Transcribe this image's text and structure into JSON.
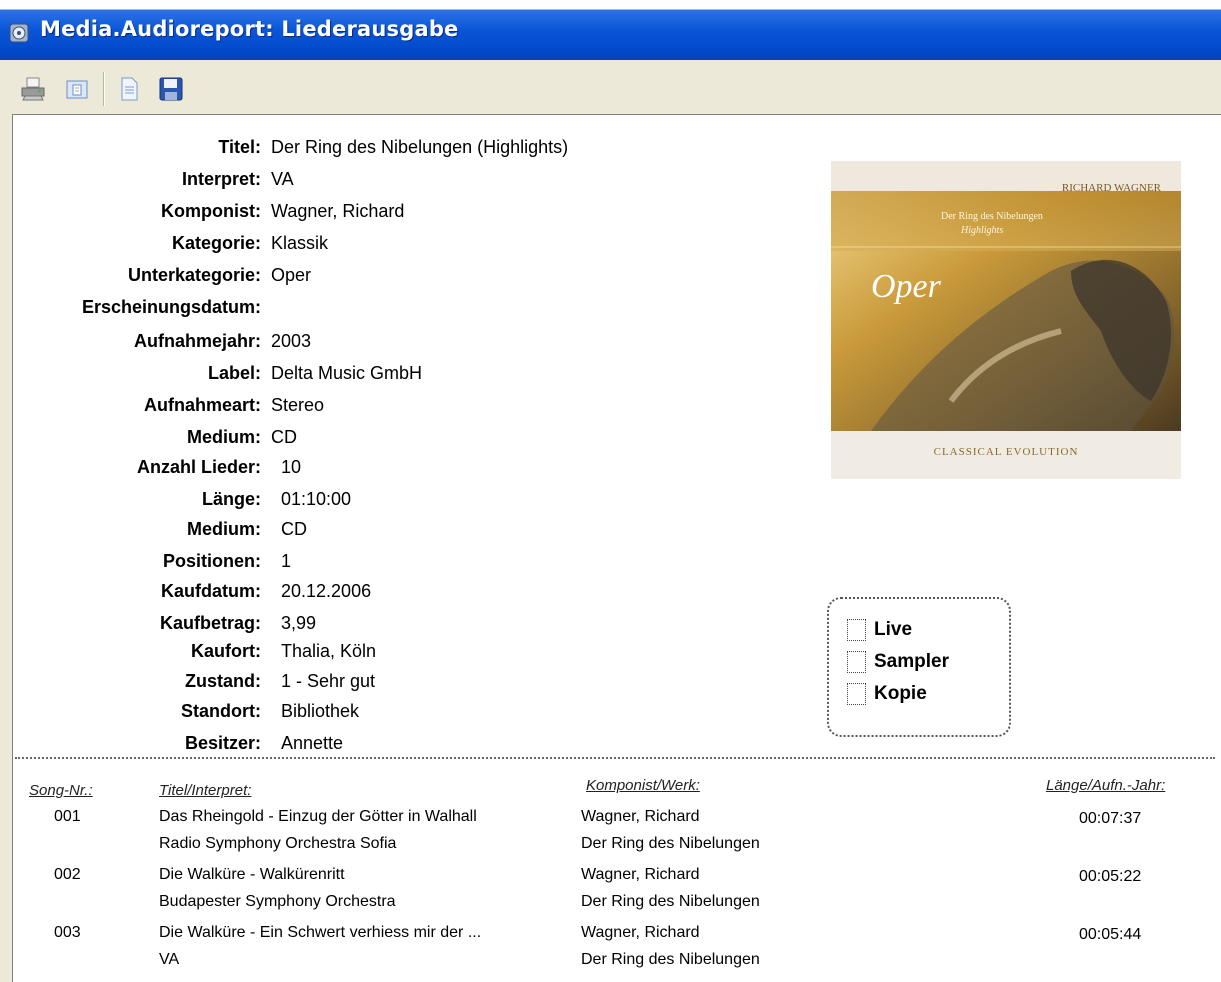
{
  "window": {
    "title": "Media.Audioreport: Liederausgabe"
  },
  "toolbar": {
    "icons": [
      "printer-icon",
      "page-view-icon",
      "document-icon",
      "save-icon"
    ]
  },
  "details": [
    {
      "label": "Titel:",
      "value": "Der Ring des Nibelungen (Highlights)"
    },
    {
      "label": "Interpret:",
      "value": "VA"
    },
    {
      "label": "Komponist:",
      "value": "Wagner, Richard"
    },
    {
      "label": "Kategorie:",
      "value": "Klassik"
    },
    {
      "label": "Unterkategorie:",
      "value": "Oper"
    },
    {
      "label": "Erscheinungsdatum:",
      "value": ""
    },
    {
      "label": "Aufnahmejahr:",
      "value": "2003"
    },
    {
      "label": "Label:",
      "value": "Delta Music GmbH"
    },
    {
      "label": "Aufnahmeart:",
      "value": "Stereo"
    },
    {
      "label": "Medium:",
      "value": "CD"
    },
    {
      "label": "Anzahl Lieder:",
      "value": "10"
    },
    {
      "label": "Länge:",
      "value": "01:10:00"
    },
    {
      "label": "Medium:",
      "value": "CD"
    },
    {
      "label": "Positionen:",
      "value": "1"
    },
    {
      "label": "Kaufdatum:",
      "value": "20.12.2006"
    },
    {
      "label": "Kaufbetrag:",
      "value": "3,99"
    },
    {
      "label": "Kaufort:",
      "value": "Thalia, Köln"
    },
    {
      "label": "Zustand:",
      "value": "1 - Sehr gut"
    },
    {
      "label": "Standort:",
      "value": "Bibliothek"
    },
    {
      "label": "Besitzer:",
      "value": "Annette"
    }
  ],
  "cover": {
    "composer": "RICHARD WAGNER",
    "work_line1": "Der Ring des Nibelungen",
    "work_line2": "Highlights",
    "genre": "Oper",
    "series": "CLASSICAL EVOLUTION"
  },
  "flags": [
    {
      "label": "Live",
      "checked": false
    },
    {
      "label": "Sampler",
      "checked": false
    },
    {
      "label": "Kopie",
      "checked": false
    }
  ],
  "table": {
    "headers": {
      "song_nr": "Song-Nr.:",
      "title": "Titel/Interpret:",
      "composer": "Komponist/Werk:",
      "length": "Länge/Aufn.-Jahr:"
    },
    "rows": [
      {
        "nr": "001",
        "title": "Das Rheingold - Einzug der Götter in Walhall",
        "interpret": "Radio Symphony Orchestra Sofia",
        "composer": "Wagner, Richard",
        "work": "Der Ring des Nibelungen",
        "length": "00:07:37"
      },
      {
        "nr": "002",
        "title": "Die Walküre - Walkürenritt",
        "interpret": "Budapester Symphony Orchestra",
        "composer": "Wagner, Richard",
        "work": "Der Ring des Nibelungen",
        "length": "00:05:22"
      },
      {
        "nr": "003",
        "title": "Die Walküre - Ein Schwert verhiess mir der ...",
        "interpret": "VA",
        "composer": "Wagner, Richard",
        "work": "Der Ring des Nibelungen",
        "length": "00:05:44"
      }
    ]
  }
}
